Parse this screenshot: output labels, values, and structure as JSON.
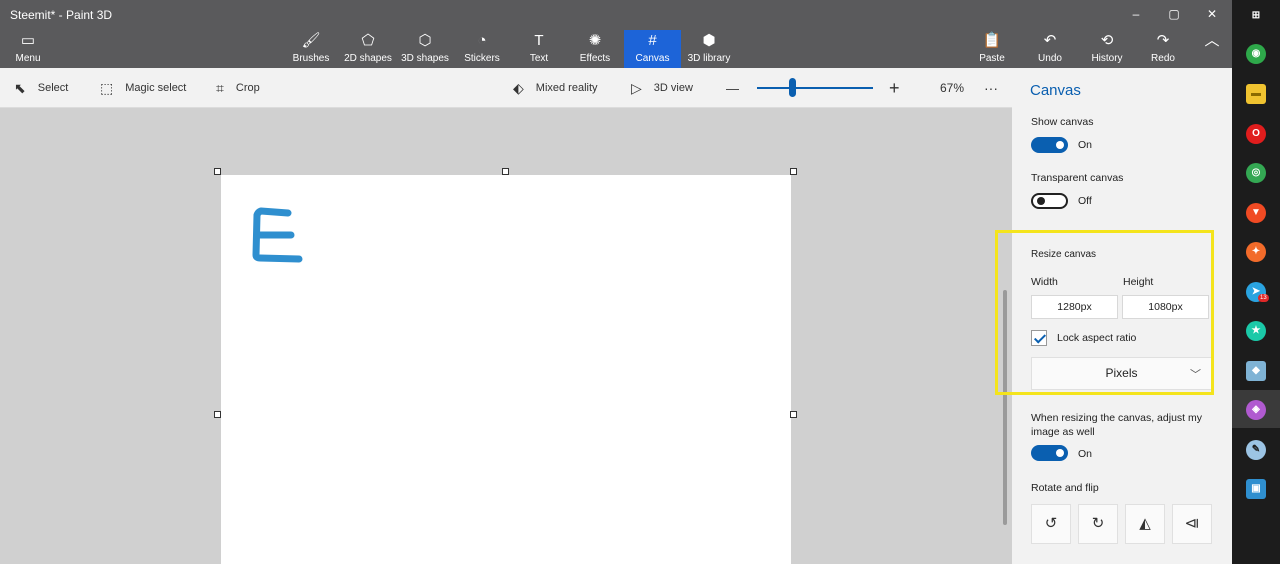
{
  "window": {
    "title": "Steemit* - Paint 3D"
  },
  "window_controls": {
    "minimize": "–",
    "maximize": "▢",
    "close": "✕"
  },
  "ribbon": {
    "menu": {
      "label": "Menu",
      "icon": "folder-icon",
      "glyph": "▭"
    },
    "tools": [
      {
        "label": "Brushes",
        "icon": "brush-icon",
        "glyph": "🖌"
      },
      {
        "label": "2D shapes",
        "icon": "2d-shapes-icon",
        "glyph": "⬠"
      },
      {
        "label": "3D shapes",
        "icon": "3d-shapes-icon",
        "glyph": "⬡"
      },
      {
        "label": "Stickers",
        "icon": "stickers-icon",
        "glyph": "◔"
      },
      {
        "label": "Text",
        "icon": "text-icon",
        "glyph": "T"
      },
      {
        "label": "Effects",
        "icon": "effects-icon",
        "glyph": "✺"
      },
      {
        "label": "Canvas",
        "icon": "canvas-icon",
        "glyph": "#"
      },
      {
        "label": "3D library",
        "icon": "3d-library-icon",
        "glyph": "⬢"
      }
    ],
    "active_tool": "Canvas",
    "actions": [
      {
        "label": "Paste",
        "icon": "paste-icon",
        "glyph": "📋"
      },
      {
        "label": "Undo",
        "icon": "undo-icon",
        "glyph": "↶"
      },
      {
        "label": "History",
        "icon": "history-icon",
        "glyph": "⟲"
      },
      {
        "label": "Redo",
        "icon": "redo-icon",
        "glyph": "↷"
      }
    ],
    "collapse_glyph": "︿"
  },
  "toolbar": {
    "select": {
      "label": "Select",
      "glyph": "⬉"
    },
    "magic_select": {
      "label": "Magic select",
      "glyph": "⬚"
    },
    "crop": {
      "label": "Crop",
      "glyph": "⌗"
    },
    "mixed_reality": {
      "label": "Mixed reality",
      "glyph": "⬖"
    },
    "view_3d": {
      "label": "3D view",
      "glyph": "▷"
    },
    "zoom_out": "—",
    "zoom_in": "+",
    "zoom_level": "67%",
    "zoom_fraction": 0.3,
    "more": "···"
  },
  "canvas_content": {
    "letter": "E",
    "color": "#2f8fcf"
  },
  "panel": {
    "title": "Canvas",
    "show_canvas": {
      "label": "Show canvas",
      "state": "On"
    },
    "transparent_canvas": {
      "label": "Transparent canvas",
      "state": "Off"
    },
    "resize": {
      "label": "Resize canvas",
      "width_label": "Width",
      "height_label": "Height",
      "width_value": "1280px",
      "height_value": "1080px",
      "lock_label": "Lock aspect ratio",
      "unit": "Pixels",
      "chevron": "﹀"
    },
    "adjust_image": {
      "label": "When resizing the canvas, adjust my image as well",
      "state": "On"
    },
    "rotate_flip": {
      "label": "Rotate and flip",
      "buttons": [
        "↺",
        "↻",
        "◭",
        "⧏"
      ]
    }
  },
  "taskbar": {
    "apps": [
      {
        "name": "windows-icon",
        "glyph": "⊞",
        "bg": "#1c1c1c",
        "fg": "#ffffff"
      },
      {
        "name": "eye-app-icon",
        "glyph": "◉",
        "bg": "#2ea84a",
        "fg": "#ffffff"
      },
      {
        "name": "file-explorer-icon",
        "glyph": "▬",
        "bg": "#f0c330",
        "fg": "#8a6a00"
      },
      {
        "name": "opera-icon",
        "glyph": "O",
        "bg": "#e01d1d",
        "fg": "#ffffff"
      },
      {
        "name": "chrome-icon",
        "glyph": "◎",
        "bg": "#34a853",
        "fg": "#ffffff"
      },
      {
        "name": "brave-icon",
        "glyph": "▼",
        "bg": "#f04a23",
        "fg": "#ffffff"
      },
      {
        "name": "orange-app-icon",
        "glyph": "✦",
        "bg": "#f26b2a",
        "fg": "#ffffff"
      },
      {
        "name": "telegram-icon",
        "glyph": "➤",
        "bg": "#2aa3e0",
        "fg": "#ffffff"
      },
      {
        "name": "star-app-icon",
        "glyph": "★",
        "bg": "#1bc9a8",
        "fg": "#ffffff"
      },
      {
        "name": "notes-app-icon",
        "glyph": "◆",
        "bg": "#7fb3d5",
        "fg": "#ffffff"
      },
      {
        "name": "paint-3d-icon",
        "glyph": "◈",
        "bg": "#b05ad0",
        "fg": "#ffffff"
      },
      {
        "name": "paint-palette-icon",
        "glyph": "✎",
        "bg": "#9cc4e4",
        "fg": "#1c1c1c"
      },
      {
        "name": "computer-app-icon",
        "glyph": "▣",
        "bg": "#2f8fcf",
        "fg": "#ffffff"
      }
    ],
    "telegram_badge": "13"
  },
  "colors": {
    "accent": "#0a5fb0",
    "ribbon_active": "#1d64d8",
    "highlight": "#f4e41c"
  }
}
